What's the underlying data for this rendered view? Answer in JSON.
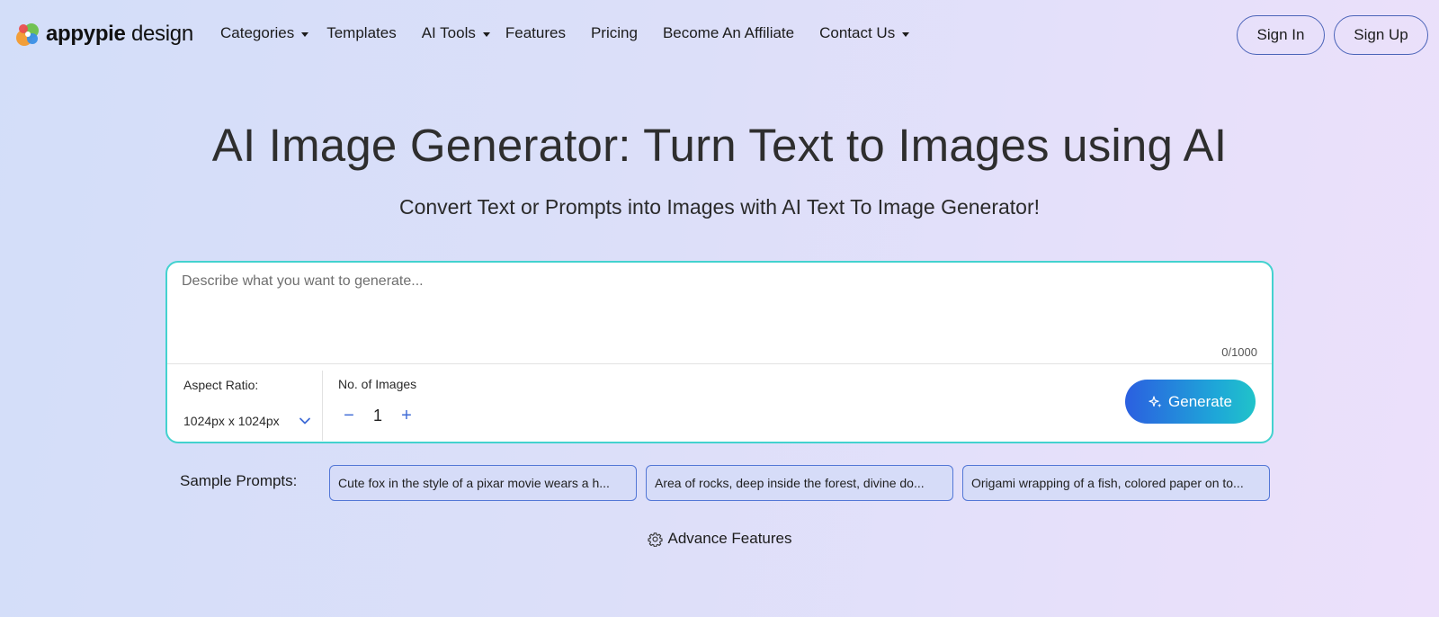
{
  "brand": {
    "name_bold": "appypie",
    "name_light": " design",
    "colors": {
      "green": "#6cc04a",
      "orange": "#f39a2e",
      "blue": "#3a8fe6",
      "red": "#ea4e4e"
    }
  },
  "nav": {
    "items": [
      {
        "label": "Categories",
        "has_dropdown": true
      },
      {
        "label": "Templates",
        "has_dropdown": false
      },
      {
        "label": "AI Tools",
        "has_dropdown": true
      },
      {
        "label": "Features",
        "has_dropdown": false
      },
      {
        "label": "Pricing",
        "has_dropdown": false
      },
      {
        "label": "Become An Affiliate",
        "has_dropdown": false
      },
      {
        "label": "Contact Us",
        "has_dropdown": true
      }
    ]
  },
  "auth": {
    "sign_in": "Sign In",
    "sign_up": "Sign Up",
    "border_color": "#4a63b8"
  },
  "hero": {
    "title": "AI Image Generator: Turn Text to Images using AI",
    "subtitle": "Convert Text or Prompts into Images with AI Text To Image Generator!"
  },
  "generator": {
    "prompt_placeholder": "Describe what you want to generate...",
    "prompt_value": "",
    "counter": "0/1000",
    "aspect_ratio_label": "Aspect Ratio:",
    "aspect_ratio_value": "1024px x 1024px",
    "num_images_label": "No. of Images",
    "num_images_value": "1",
    "decrement_symbol": "−",
    "increment_symbol": "+",
    "generate_label": "Generate",
    "accent_border": "#43d2cf",
    "generate_gradient": [
      "#2b5fe0",
      "#20c3c9"
    ]
  },
  "samples": {
    "label": "Sample Prompts:",
    "chips": [
      "Cute fox in the style of a pixar movie wears a h...",
      "Area of rocks, deep inside the forest, divine do...",
      "Origami wrapping of a fish, colored paper on to..."
    ]
  },
  "advance": {
    "label": "Advance Features"
  }
}
